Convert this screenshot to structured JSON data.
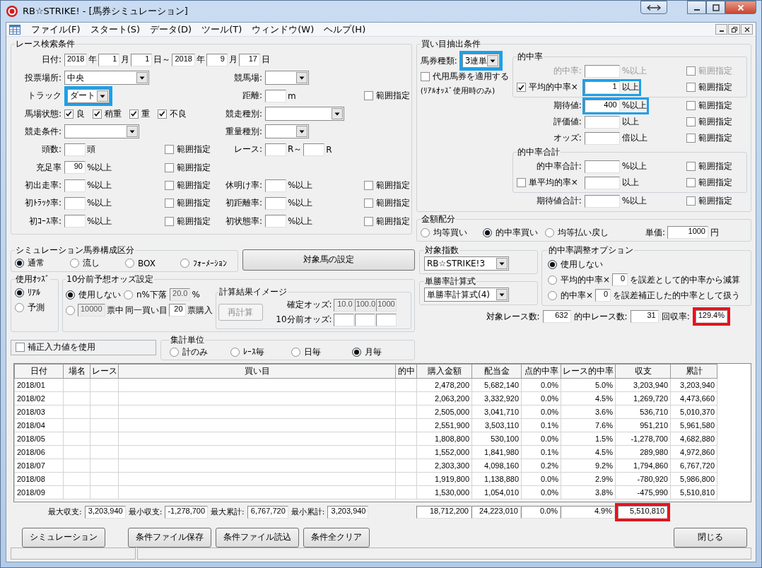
{
  "window": {
    "title": "RB☆STRIKE! - [馬券シミュレーション]"
  },
  "menu": [
    "ファイル(F)",
    "スタート(S)",
    "データ(D)",
    "ツール(T)",
    "ウィンドウ(W)",
    "ヘルプ(H)"
  ],
  "race_search": {
    "legend": "レース検索条件",
    "rows": [
      {
        "label": "日付:",
        "inputs": [
          {
            "kind": "field",
            "value": "2018"
          },
          {
            "kind": "text",
            "text": "年"
          },
          {
            "kind": "field",
            "value": "1"
          },
          {
            "kind": "text",
            "text": "月"
          },
          {
            "kind": "field",
            "value": "1"
          },
          {
            "kind": "text",
            "text": "日～"
          },
          {
            "kind": "field",
            "value": "2018"
          },
          {
            "kind": "text",
            "text": "年"
          },
          {
            "kind": "field",
            "value": "9"
          },
          {
            "kind": "text",
            "text": "月"
          },
          {
            "kind": "field",
            "value": "17"
          },
          {
            "kind": "text",
            "text": "日"
          }
        ]
      },
      {
        "label": "投票場所:",
        "inputs": [
          {
            "kind": "combo",
            "value": "中央"
          }
        ],
        "sub_label": "競馬場:",
        "sub_inputs": [
          {
            "kind": "combo"
          }
        ]
      },
      {
        "label": "トラック",
        "inputs": [
          {
            "kind": "combo",
            "value": "ダート",
            "color": "#1ea0e6"
          }
        ],
        "sub_label": "距離:",
        "sub_inputs": [
          {
            "kind": "field"
          },
          {
            "kind": "text",
            "text": "m"
          }
        ],
        "sub_range_check": {
          "kind": "check",
          "label": "範囲指定",
          "checked": false
        }
      },
      {
        "label": "馬場状態:",
        "inputs": [
          {
            "kind": "check",
            "label": "良",
            "checked": true
          },
          {
            "kind": "check",
            "label": "稍重",
            "checked": true
          },
          {
            "kind": "check",
            "label": "重",
            "checked": true
          },
          {
            "kind": "check",
            "label": "不良",
            "checked": true
          }
        ],
        "sub_label": "競走種別:",
        "sub_inputs": [
          {
            "kind": "combo"
          }
        ]
      },
      {
        "label": "競走条件:",
        "inputs": [
          {
            "kind": "combo"
          }
        ],
        "sub_label": "重量種別:",
        "sub_inputs": [
          {
            "kind": "combo"
          }
        ]
      },
      {
        "label": "頭数:",
        "inputs": [
          {
            "kind": "field"
          },
          {
            "kind": "text",
            "text": "頭"
          }
        ],
        "range_check": {
          "kind": "check",
          "label": "範囲指定",
          "checked": false
        },
        "sub_label": "レース:",
        "sub_inputs": [
          {
            "kind": "field"
          },
          {
            "kind": "text",
            "text": "R～"
          },
          {
            "kind": "field"
          },
          {
            "kind": "text",
            "text": "R"
          }
        ]
      },
      {
        "label": "充足率",
        "inputs": [
          {
            "kind": "field",
            "value": "90"
          },
          {
            "kind": "text",
            "text": "%以上"
          }
        ],
        "range_check": {
          "kind": "check",
          "label": "範囲指定",
          "checked": false
        }
      },
      {
        "label": "初出走率:",
        "inputs": [
          {
            "kind": "field"
          },
          {
            "kind": "text",
            "text": "%以上"
          }
        ],
        "range_check": {
          "kind": "check",
          "label": "範囲指定",
          "checked": false
        },
        "sub_label": "休明け率:",
        "sub_inputs": [
          {
            "kind": "field"
          },
          {
            "kind": "text",
            "text": "%以上"
          }
        ],
        "sub_range_check": {
          "kind": "check",
          "label": "範囲指定",
          "checked": false
        }
      },
      {
        "label": "初ﾄﾗｯｸ率:",
        "inputs": [
          {
            "kind": "field"
          },
          {
            "kind": "text",
            "text": "%以上"
          }
        ],
        "range_check": {
          "kind": "check",
          "label": "範囲指定",
          "checked": false
        },
        "sub_label": "初距離率:",
        "sub_inputs": [
          {
            "kind": "field"
          },
          {
            "kind": "text",
            "text": "%以上"
          }
        ],
        "sub_range_check": {
          "kind": "check",
          "label": "範囲指定",
          "checked": false
        }
      },
      {
        "label": "初ｺｰｽ率:",
        "inputs": [
          {
            "kind": "field"
          },
          {
            "kind": "text",
            "text": "%以上"
          }
        ],
        "range_check": {
          "kind": "check",
          "label": "範囲指定",
          "checked": false
        },
        "sub_label": "初状態率:",
        "sub_inputs": [
          {
            "kind": "field"
          },
          {
            "kind": "text",
            "text": "%以上"
          }
        ],
        "sub_range_check": {
          "kind": "check",
          "label": "範囲指定",
          "checked": false
        }
      }
    ]
  },
  "bet_extraction": {
    "legend": "買い目抽出条件",
    "ticket_type": {
      "label": "馬券種類:",
      "combo": {
        "kind": "combo",
        "value": "3連単",
        "color": "#1ea0e6"
      }
    },
    "substitute": {
      "kind": "check",
      "label": "代用馬券を適用する",
      "checked": false
    },
    "note": "(ﾘｱﾙｵｯｽﾞ使用時のみ)",
    "groups": [
      {
        "legend": "的中率",
        "rows": [
          {
            "label": "的中率:",
            "field": {
              "kind": "field"
            },
            "unit": "%以上",
            "range_check": {
              "kind": "check",
              "label": "範囲指定",
              "checked": false
            },
            "disabled": true
          },
          {
            "check": {
              "kind": "check",
              "label": "平均的中率×",
              "checked": true
            },
            "field": {
              "kind": "field",
              "value": "1"
            },
            "unit": "以上",
            "color": "#1ea0e6",
            "range_check": {
              "kind": "check",
              "label": "範囲指定",
              "checked": false
            },
            "disabled": false
          }
        ]
      },
      {
        "rows": [
          {
            "label": "期待値:",
            "field": {
              "kind": "field",
              "value": "400"
            },
            "unit": "%以上",
            "color": "#1ea0e6",
            "range_check": {
              "kind": "check",
              "label": "範囲指定",
              "checked": false
            },
            "disabled": false
          },
          {
            "label": "評価値:",
            "field": {
              "kind": "field"
            },
            "unit": "以上",
            "range_check": {
              "kind": "check",
              "label": "範囲指定",
              "checked": false
            },
            "disabled": false
          },
          {
            "label": "オッズ:",
            "field": {
              "kind": "field"
            },
            "unit": "倍以上",
            "range_check": {
              "kind": "check",
              "label": "範囲指定",
              "checked": false
            },
            "disabled": false
          }
        ]
      },
      {
        "legend": "的中率合計",
        "rows": [
          {
            "label": "的中率合計:",
            "field": {
              "kind": "field"
            },
            "unit": "%以上",
            "range_check": {
              "kind": "check",
              "label": "範囲指定",
              "checked": false
            },
            "disabled": false
          },
          {
            "check": {
              "kind": "check",
              "label": "単平均的率×",
              "checked": false
            },
            "field": {
              "kind": "field"
            },
            "unit": "以上",
            "range_check": {
              "kind": "check",
              "label": "範囲指定",
              "checked": false
            },
            "disabled": false
          }
        ]
      },
      {
        "rows": [
          {
            "label": "期待値合計:",
            "field": {
              "kind": "field"
            },
            "unit": "%以上",
            "range_check": {
              "kind": "check",
              "label": "範囲指定",
              "checked": false
            },
            "disabled": false
          }
        ]
      }
    ]
  },
  "allocation": {
    "legend": "金額配分",
    "options": [
      {
        "kind": "radio",
        "label": "均等買い",
        "selected": false
      },
      {
        "kind": "radio",
        "label": "的中率買い",
        "selected": true
      },
      {
        "kind": "radio",
        "label": "均等払い戻し",
        "selected": false
      }
    ],
    "unit_price": [
      {
        "kind": "text",
        "text": "単価:"
      },
      {
        "kind": "field",
        "value": "1000"
      },
      {
        "kind": "text",
        "text": "円"
      }
    ]
  },
  "composition": {
    "legend": "シミュレーション馬券構成区分",
    "options": [
      {
        "kind": "radio",
        "label": "通常",
        "selected": true
      },
      {
        "kind": "radio",
        "label": "流し",
        "selected": false
      },
      {
        "kind": "radio",
        "label": "BOX",
        "selected": false
      },
      {
        "kind": "radio",
        "label": "ﾌｫｰﾒｰｼｮﾝ",
        "selected": false
      }
    ]
  },
  "target_horse_button": {
    "label": "対象馬の設定"
  },
  "odds_used": {
    "legend": "使用ｵｯｽﾞ",
    "options": [
      {
        "kind": "radio",
        "label": "ﾘｱﾙ",
        "selected": true
      },
      {
        "kind": "radio",
        "label": "予測",
        "selected": false
      }
    ]
  },
  "ten_min": {
    "legend": "10分前予想オッズ設定",
    "lines": [
      {
        "items": [
          {
            "kind": "radio",
            "label": "使用しない",
            "selected": true
          },
          {
            "kind": "radio",
            "label": "n%下落",
            "selected": false
          },
          {
            "kind": "field",
            "value": "20.0",
            "disabled": true
          },
          {
            "kind": "text",
            "text": "%"
          }
        ]
      },
      {
        "items": [
          {
            "kind": "radio",
            "selected": false
          },
          {
            "kind": "field",
            "value": "10000",
            "disabled": true
          },
          {
            "kind": "text",
            "text": "票中"
          },
          {
            "kind": "text",
            "text": "同一買い目"
          },
          {
            "kind": "field",
            "value": "20",
            "disabled": false
          },
          {
            "kind": "text",
            "text": "票購入"
          }
        ]
      }
    ],
    "preview": {
      "legend": "計算結果イメージ",
      "button": {
        "label": "再計算",
        "disabled": true
      },
      "rows": [
        {
          "label": "確定オッズ:",
          "fields": [
            {
              "kind": "field",
              "value": "10.0",
              "disabled": true
            },
            {
              "kind": "field",
              "value": "100.0",
              "disabled": true
            },
            {
              "kind": "field",
              "value": "1000",
              "disabled": true
            }
          ]
        },
        {
          "label": "10分前オッズ:",
          "fields": [
            {
              "kind": "field",
              "disabled": false
            },
            {
              "kind": "field",
              "disabled": false
            },
            {
              "kind": "field",
              "disabled": false
            }
          ]
        }
      ]
    }
  },
  "correction": {
    "kind": "check",
    "label": "補正入力値を使用",
    "checked": false
  },
  "aggregate": {
    "legend": "集計単位",
    "options": [
      {
        "kind": "radio",
        "label": "計のみ",
        "selected": false
      },
      {
        "kind": "radio",
        "label": "ﾚｰｽ毎",
        "selected": false
      },
      {
        "kind": "radio",
        "label": "日毎",
        "selected": false
      },
      {
        "kind": "radio",
        "label": "月毎",
        "selected": true
      }
    ]
  },
  "target_index": {
    "legend": "対象指数",
    "combo": {
      "kind": "combo",
      "value": "RB☆STRIKE!3"
    }
  },
  "win_rate_formula": {
    "legend": "単勝率計算式",
    "combo": {
      "kind": "combo",
      "value": "単勝率計算式(4)"
    }
  },
  "adjust_option": {
    "legend": "的中率調整オプション",
    "lines": [
      {
        "items": [
          {
            "kind": "radio",
            "label": "使用しない",
            "selected": true
          }
        ]
      },
      {
        "items": [
          {
            "kind": "radio",
            "label": "平均的中率×",
            "selected": false
          },
          {
            "kind": "field",
            "value": "0"
          },
          {
            "kind": "text",
            "text": "を誤差として的中率から減算"
          }
        ]
      },
      {
        "items": [
          {
            "kind": "radio",
            "label": "的中率×",
            "selected": false
          },
          {
            "kind": "field",
            "value": "0"
          },
          {
            "kind": "text",
            "text": "を誤差補正した的中率として扱う"
          }
        ]
      }
    ]
  },
  "stats": [
    {
      "kind": "text",
      "text": "対象レース数:"
    },
    {
      "kind": "field",
      "value": "632"
    },
    {
      "kind": "text",
      "text": "的中レース数:"
    },
    {
      "kind": "field",
      "value": "31"
    },
    {
      "kind": "text",
      "text": "回収率:"
    },
    {
      "kind": "field",
      "value": "129.4%",
      "color": "#e6141e"
    }
  ],
  "table": {
    "columns": [
      "日付",
      "場名",
      "レース",
      "買い目",
      "的中",
      "購入金額",
      "配当金",
      "点的中率",
      "レース的中率",
      "収支",
      "累計"
    ],
    "rows": [
      {
        "date": "2018/01",
        "purchase": "2,478,200",
        "payout": "5,682,140",
        "point_rate": "0.0%",
        "race_rate": "5.0%",
        "balance": "3,203,940",
        "cumulative": "3,203,940"
      },
      {
        "date": "2018/02",
        "purchase": "2,063,200",
        "payout": "3,332,920",
        "point_rate": "0.0%",
        "race_rate": "4.5%",
        "balance": "1,269,720",
        "cumulative": "4,473,660"
      },
      {
        "date": "2018/03",
        "purchase": "2,505,000",
        "payout": "3,041,710",
        "point_rate": "0.0%",
        "race_rate": "3.6%",
        "balance": "536,710",
        "cumulative": "5,010,370"
      },
      {
        "date": "2018/04",
        "purchase": "2,551,900",
        "payout": "3,503,110",
        "point_rate": "0.1%",
        "race_rate": "7.6%",
        "balance": "951,210",
        "cumulative": "5,961,580"
      },
      {
        "date": "2018/05",
        "purchase": "1,808,800",
        "payout": "530,100",
        "point_rate": "0.0%",
        "race_rate": "1.5%",
        "balance": "-1,278,700",
        "cumulative": "4,682,880"
      },
      {
        "date": "2018/06",
        "purchase": "1,552,000",
        "payout": "1,841,980",
        "point_rate": "0.1%",
        "race_rate": "4.5%",
        "balance": "289,980",
        "cumulative": "4,972,860"
      },
      {
        "date": "2018/07",
        "purchase": "2,303,300",
        "payout": "4,098,160",
        "point_rate": "0.2%",
        "race_rate": "9.2%",
        "balance": "1,794,860",
        "cumulative": "6,767,720"
      },
      {
        "date": "2018/08",
        "purchase": "1,919,800",
        "payout": "1,138,880",
        "point_rate": "0.0%",
        "race_rate": "2.9%",
        "balance": "-780,920",
        "cumulative": "5,986,800"
      },
      {
        "date": "2018/09",
        "purchase": "1,530,000",
        "payout": "1,054,010",
        "point_rate": "0.0%",
        "race_rate": "3.8%",
        "balance": "-475,990",
        "cumulative": "5,510,810"
      }
    ]
  },
  "summary": {
    "stats": [
      {
        "kind": "text",
        "text": "最大収支:"
      },
      {
        "kind": "field",
        "value": "3,203,940"
      },
      {
        "kind": "text",
        "text": "最小収支:"
      },
      {
        "kind": "field",
        "value": "-1,278,700"
      },
      {
        "kind": "text",
        "text": "最大累計:"
      },
      {
        "kind": "field",
        "value": "6,767,720"
      },
      {
        "kind": "text",
        "text": "最小累計:"
      },
      {
        "kind": "field",
        "value": "3,203,940"
      }
    ],
    "totals": [
      {
        "kind": "field",
        "value": "18,712,200"
      },
      {
        "kind": "field",
        "value": "24,223,010"
      },
      {
        "kind": "field",
        "value": "0.0%"
      },
      {
        "kind": "field",
        "value": "4.9%"
      },
      {
        "kind": "field",
        "value": "5,510,810",
        "color": "#e6141e"
      }
    ]
  },
  "buttons": [
    {
      "label": "シミュレーション"
    },
    {
      "label": "条件ファイル保存"
    },
    {
      "label": "条件ファイル読込"
    },
    {
      "label": "条件全クリア"
    },
    {
      "label": "閉じる"
    }
  ]
}
